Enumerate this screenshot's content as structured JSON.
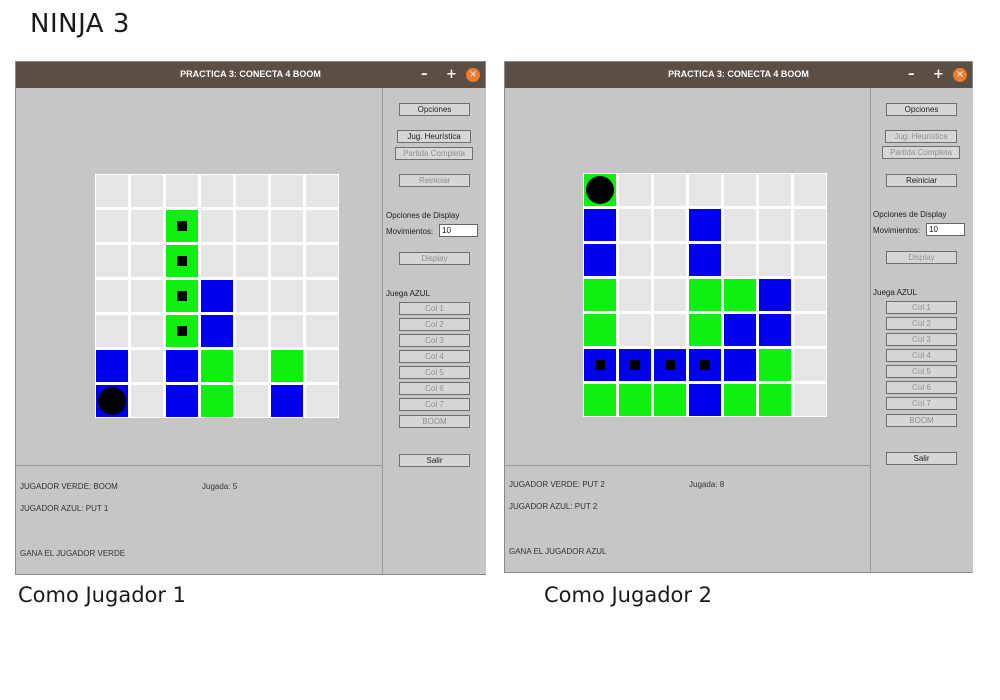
{
  "page_title": "NINJA 3",
  "windows": [
    {
      "caption": "Como Jugador 1",
      "title": "PRACTICA 3: CONECTA 4 BOOM",
      "controls": {
        "minimize": "–",
        "maximize": "+",
        "close": "×"
      },
      "board": [
        [
          "e",
          "e",
          "e",
          "e",
          "e",
          "e",
          "e"
        ],
        [
          "e",
          "e",
          "gm",
          "e",
          "e",
          "e",
          "e"
        ],
        [
          "e",
          "e",
          "gm",
          "e",
          "e",
          "e",
          "e"
        ],
        [
          "e",
          "e",
          "gm",
          "b",
          "e",
          "e",
          "e"
        ],
        [
          "e",
          "e",
          "gm",
          "b",
          "e",
          "e",
          "e"
        ],
        [
          "b",
          "e",
          "b",
          "g",
          "e",
          "g",
          "e"
        ],
        [
          "bd",
          "e",
          "b",
          "g",
          "e",
          "b",
          "e"
        ]
      ],
      "status": {
        "verde": "JUGADOR VERDE: BOOM",
        "jugada": "Jugada: 5",
        "azul": "JUGADOR AZUL: PUT 1",
        "winner": "GANA EL JUGADOR VERDE"
      },
      "panel": {
        "opciones": "Opciones",
        "heuristica": "Jug. Heurística",
        "partida": "Partida Completa",
        "reiniciar": "Reiniciar",
        "display_options": "Opciones de Display",
        "movimientos_label": "Movimientos:",
        "movimientos_value": "10",
        "display": "Display",
        "juega": "Juega AZUL",
        "cols": [
          "Col 1",
          "Col 2",
          "Col 3",
          "Col 4",
          "Col 5",
          "Col 6",
          "Col 7"
        ],
        "boom": "BOOM",
        "salir": "Salir"
      }
    },
    {
      "caption": "Como Jugador 2",
      "title": "PRACTICA 3: CONECTA 4 BOOM",
      "controls": {
        "minimize": "–",
        "maximize": "+",
        "close": "×"
      },
      "board": [
        [
          "gd",
          "e",
          "e",
          "e",
          "e",
          "e",
          "e"
        ],
        [
          "b",
          "e",
          "e",
          "b",
          "e",
          "e",
          "e"
        ],
        [
          "b",
          "e",
          "e",
          "b",
          "e",
          "e",
          "e"
        ],
        [
          "g",
          "e",
          "e",
          "g",
          "g",
          "b",
          "e"
        ],
        [
          "g",
          "e",
          "e",
          "g",
          "b",
          "b",
          "e"
        ],
        [
          "bm",
          "bm",
          "bm",
          "bm",
          "b",
          "g",
          "e"
        ],
        [
          "g",
          "g",
          "g",
          "b",
          "g",
          "g",
          "e"
        ]
      ],
      "status": {
        "verde": "JUGADOR VERDE: PUT 2",
        "jugada": "Jugada: 8",
        "azul": "JUGADOR AZUL: PUT 2",
        "winner": "GANA EL JUGADOR AZUL"
      },
      "panel": {
        "opciones": "Opciones",
        "heuristica": "Jug. Heurística",
        "partida": "Partida Completa",
        "reiniciar": "Reiniciar",
        "display_options": "Opciones de Display",
        "movimientos_label": "Movimientos:",
        "movimientos_value": "10",
        "display": "Display",
        "juega": "Juega AZUL",
        "cols": [
          "Col 1",
          "Col 2",
          "Col 3",
          "Col 4",
          "Col 5",
          "Col 6",
          "Col 7"
        ],
        "boom": "BOOM",
        "salir": "Salir"
      }
    }
  ]
}
